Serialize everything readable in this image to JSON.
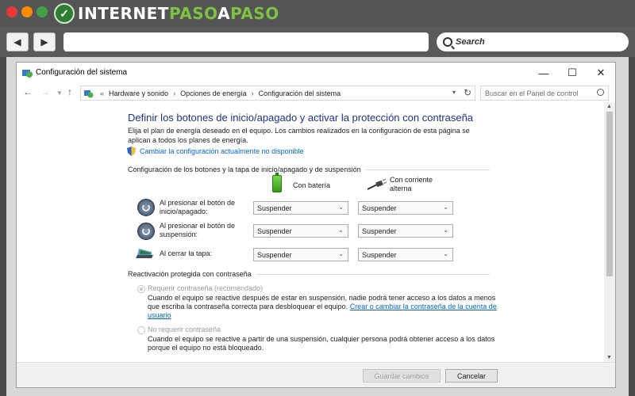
{
  "brand": {
    "part1": "INTERNET",
    "part2": "PASO",
    "part3": "A",
    "part4": "PASO"
  },
  "browser": {
    "back": "◀",
    "forward": "▶",
    "search_label": "Search"
  },
  "window": {
    "title": "Configuración del sistema",
    "controls": {
      "minimize": "—",
      "maximize": "☐",
      "close": "✕"
    }
  },
  "address": {
    "prefix": "«",
    "crumbs": [
      "Hardware y sonido",
      "Opciones de energía",
      "Configuración del sistema"
    ],
    "separator": "›",
    "search_placeholder": "Buscar en el Panel de control"
  },
  "content": {
    "heading": "Definir los botones de inicio/apagado y activar la protección con contraseña",
    "description": "Elija el plan de energía deseado en el equipo. Los cambios realizados en la configuración de esta página se aplican a todos los planes de energía.",
    "change_link": "Cambiar la configuración actualmente no disponible",
    "section1": "Configuración de los botones y la tapa de inicio/apagado y de suspensión",
    "col_battery": "Con batería",
    "col_ac": "Con corriente alterna",
    "rows": [
      {
        "label": "Al presionar el botón de inicio/apagado:",
        "battery": "Suspender",
        "ac": "Suspender"
      },
      {
        "label": "Al presionar el botón de suspensión:",
        "battery": "Suspender",
        "ac": "Suspender"
      },
      {
        "label": "Al cerrar la tapa:",
        "battery": "Suspender",
        "ac": "Suspender"
      }
    ],
    "section2": "Reactivación protegida con contraseña",
    "option1": {
      "label": "Requerir contraseña (recomendado)",
      "desc": "Cuando el equipo se reactive después de estar en suspensión, nadie podrá tener acceso a los datos a menos que escriba la contraseña correcta para desbloquear el equipo.",
      "link": "Crear o cambiar la contraseña de la cuenta de usuario",
      "selected": true
    },
    "option2": {
      "label": "No requerir contraseña",
      "desc": "Cuando el equipo se reactive a partir de una suspensión, cualquier persona podrá obtener acceso a los datos porque el equipo no está bloqueado.",
      "selected": false
    }
  },
  "footer": {
    "save": "Guardar cambios",
    "cancel": "Cancelar"
  },
  "colors": {
    "heading": "#1e3287",
    "link": "#0066cc"
  }
}
